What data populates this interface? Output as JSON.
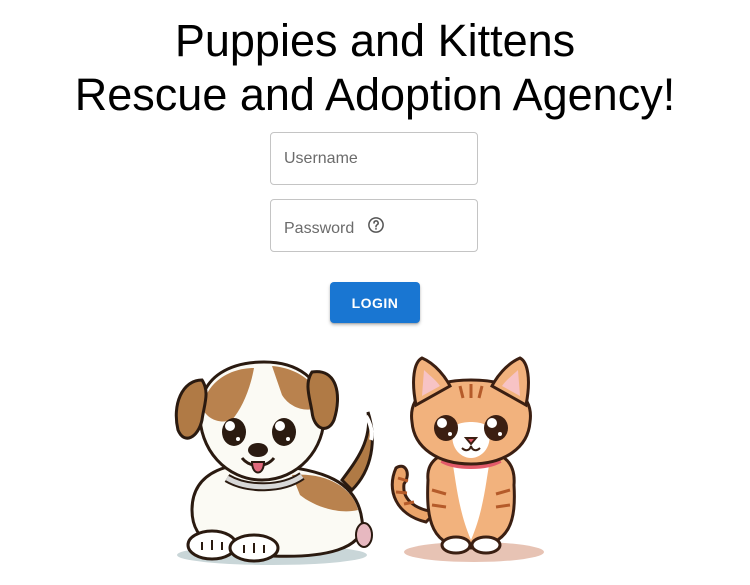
{
  "header": {
    "title_line1": "Puppies and Kittens",
    "title_line2": "Rescue and Adoption Agency!"
  },
  "login_form": {
    "username_placeholder": "Username",
    "password_label": "Password",
    "help_icon": "help-circle-icon",
    "login_label": "LOGIN"
  },
  "images": {
    "puppy": "puppy-illustration",
    "kitten": "kitten-illustration"
  },
  "colors": {
    "primary": "#1976d2",
    "field_border": "#c4c4c4",
    "placeholder": "#6b6b6b"
  }
}
